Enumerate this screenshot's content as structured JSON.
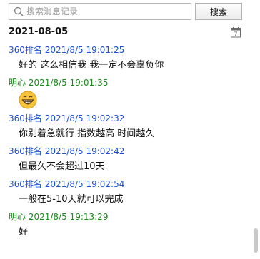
{
  "search": {
    "placeholder": "搜索消息记录",
    "button_label": "搜索"
  },
  "date_label": "2021-08-05",
  "colors": {
    "sender_a": "#1a4fd6",
    "sender_b": "#1a8a1a"
  },
  "messages": [
    {
      "sender": "360排名",
      "time": "2021/8/5 19:01:25",
      "text": "好的 这么相信我 我一定不会辜负你",
      "emoji": false
    },
    {
      "sender": "明心",
      "time": "2021/8/5 19:01:35",
      "text": "",
      "emoji": true
    },
    {
      "sender": "360排名",
      "time": "2021/8/5 19:02:32",
      "text": "你别着急就行 指数越高 时间越久",
      "emoji": false
    },
    {
      "sender": "360排名",
      "time": "2021/8/5 19:02:42",
      "text": "但最久不会超过10天",
      "emoji": false
    },
    {
      "sender": "360排名",
      "time": "2021/8/5 19:02:54",
      "text": "一般在5-10天就可以完成",
      "emoji": false
    },
    {
      "sender": "明心",
      "time": "2021/8/5 19:13:29",
      "text": "好",
      "emoji": false
    }
  ],
  "icons": {
    "search": "search-icon",
    "calendar": "calendar-icon",
    "emoji": "grin-emoji-icon"
  }
}
